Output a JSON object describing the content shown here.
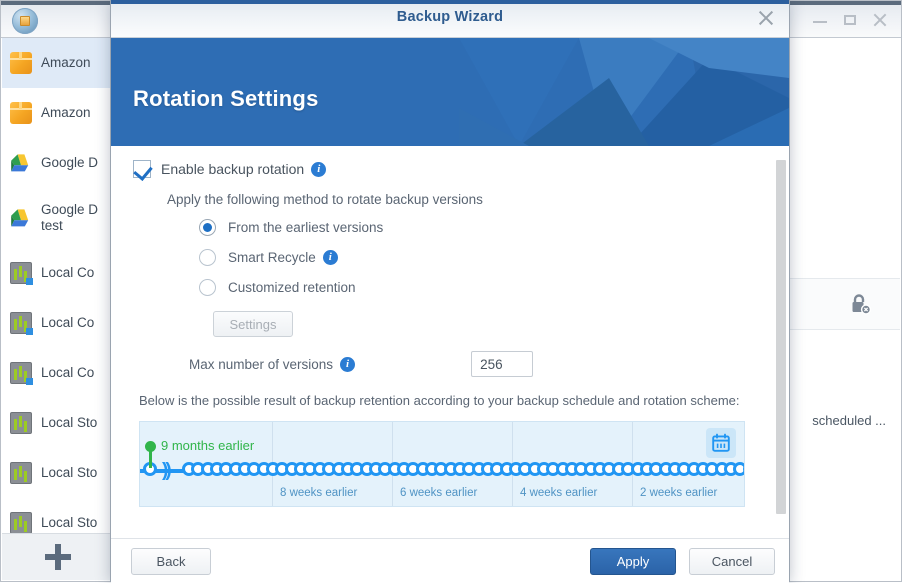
{
  "app": {
    "icon": "hyper-backup-icon",
    "window_controls": {
      "minimize": "minimize-icon",
      "maximize": "maximize-icon",
      "close": "close-icon"
    },
    "sidebar": {
      "items": [
        {
          "label": "Amazon",
          "icon": "amazon-glacier-icon",
          "selected": true,
          "two_line": false
        },
        {
          "label": "Amazon",
          "icon": "amazon-glacier-icon",
          "selected": false,
          "two_line": false
        },
        {
          "label": "Google D",
          "icon": "google-drive-icon",
          "selected": false,
          "two_line": false
        },
        {
          "label": "Google D\ntest",
          "icon": "google-drive-icon",
          "selected": false,
          "two_line": true
        },
        {
          "label": "Local Co",
          "icon": "local-folder-icon",
          "selected": false,
          "two_line": false
        },
        {
          "label": "Local Co",
          "icon": "local-folder-icon",
          "selected": false,
          "two_line": false
        },
        {
          "label": "Local Co",
          "icon": "local-folder-icon",
          "selected": false,
          "two_line": false
        },
        {
          "label": "Local Sto",
          "icon": "local-storage-icon",
          "selected": false,
          "two_line": false
        },
        {
          "label": "Local Sto",
          "icon": "local-storage-icon",
          "selected": false,
          "two_line": false
        },
        {
          "label": "Local Sto",
          "icon": "local-storage-icon",
          "selected": false,
          "two_line": false
        }
      ],
      "add_button": "add-task-button"
    },
    "content": {
      "lock_icon": "lock-disabled-icon",
      "status_text": "scheduled ..."
    }
  },
  "dialog": {
    "title": "Backup Wizard",
    "close_label": "close-icon",
    "banner_heading": "Rotation Settings",
    "accent_color": "#2e6db4",
    "enable_rotation": {
      "label": "Enable backup rotation",
      "checked": true,
      "info_icon": "info-icon"
    },
    "method_text": "Apply the following method to rotate backup versions",
    "rotation_options": [
      {
        "label": "From the earliest versions",
        "selected": true,
        "info_icon": null
      },
      {
        "label": "Smart Recycle",
        "selected": false,
        "info_icon": "info-icon"
      },
      {
        "label": "Customized retention",
        "selected": false,
        "info_icon": null
      }
    ],
    "settings_button": {
      "label": "Settings",
      "disabled": true
    },
    "max_versions": {
      "label": "Max number of versions",
      "value": "256",
      "info_icon": "info-icon"
    },
    "retention_note": "Below is the possible result of backup retention according to your backup schedule and rotation scheme:",
    "timeline": {
      "marker_label": "9 months earlier",
      "marker_color": "#31b54a",
      "axis_color": "#2196f3",
      "week_labels": [
        "8 weeks earlier",
        "6 weeks earlier",
        "4 weeks earlier",
        "2 weeks earlier"
      ],
      "calendar_button": "calendar-icon",
      "dot_count": 62
    },
    "footer": {
      "back": "Back",
      "apply": "Apply",
      "cancel": "Cancel"
    }
  }
}
